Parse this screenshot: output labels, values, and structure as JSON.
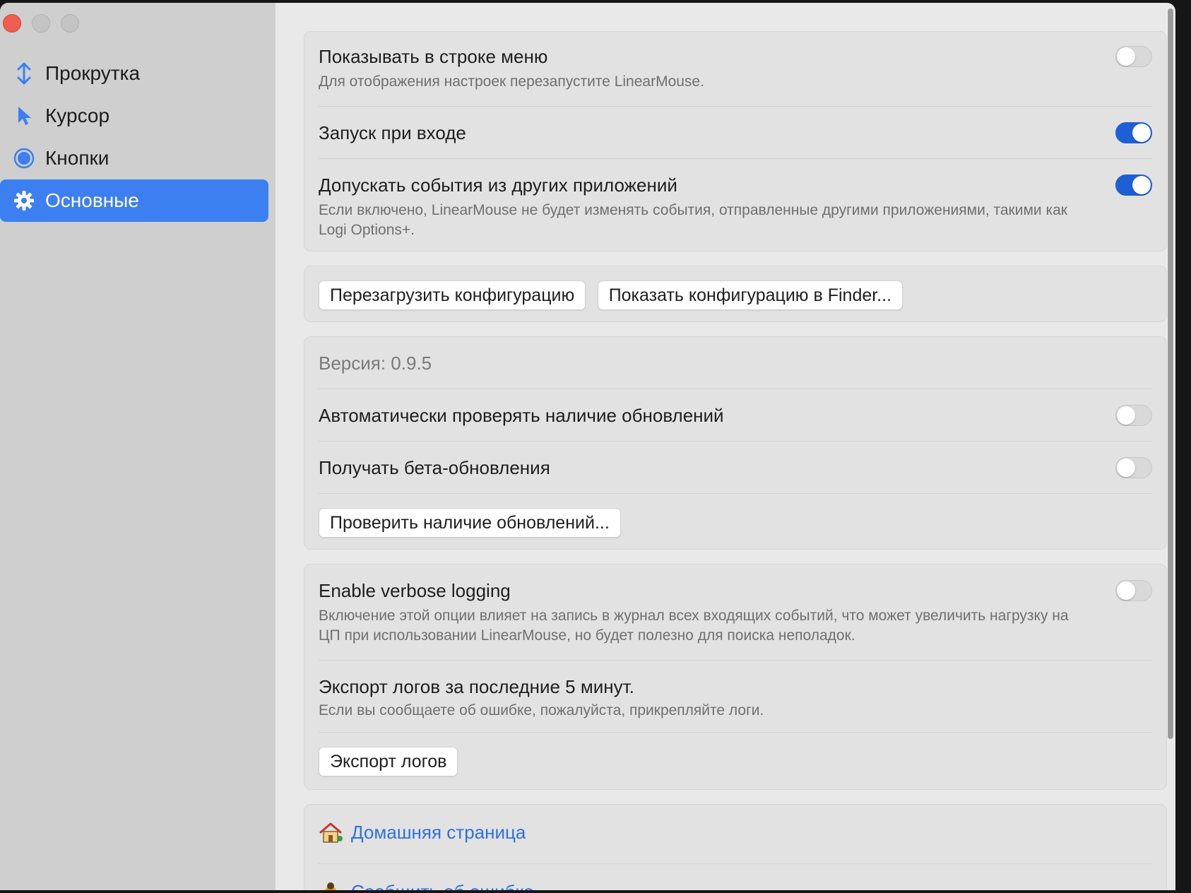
{
  "sidebar": {
    "items": [
      {
        "label": "Прокрутка",
        "icon": "scroll-arrows-icon"
      },
      {
        "label": "Курсор",
        "icon": "cursor-arrow-icon"
      },
      {
        "label": "Кнопки",
        "icon": "circle-button-icon"
      },
      {
        "label": "Основные",
        "icon": "gear-icon",
        "active": true
      }
    ]
  },
  "general": {
    "menubar": {
      "title": "Показывать в строке меню",
      "desc": "Для отображения настроек перезапустите LinearMouse.",
      "on": false
    },
    "login": {
      "title": "Запуск при входе",
      "on": true
    },
    "passthrough": {
      "title": "Допускать события из других приложений",
      "desc": "Если включено, LinearMouse не будет изменять события, отправленные другими приложениями, такими как Logi Options+.",
      "on": true
    }
  },
  "config": {
    "reload_label": "Перезагрузить конфигурацию",
    "reveal_label": "Показать конфигурацию в Finder..."
  },
  "updates": {
    "version": "Версия: 0.9.5",
    "auto_check": {
      "title": "Автоматически проверять наличие обновлений",
      "on": false
    },
    "beta": {
      "title": "Получать бета-обновления",
      "on": false
    },
    "check_label": "Проверить наличие обновлений..."
  },
  "logging": {
    "verbose": {
      "title": "Enable verbose logging",
      "desc": "Включение этой опции влияет на запись в журнал всех входящих событий, что может увеличить нагрузку на ЦП при использовании LinearMouse, но будет полезно для поиска неполадок.",
      "on": false
    },
    "export": {
      "title": "Экспорт логов за последние 5 минут.",
      "desc": "Если вы сообщаете об ошибке, пожалуйста, прикрепляйте логи."
    },
    "export_label": "Экспорт логов"
  },
  "links": {
    "homepage": "Домашняя страница",
    "bug_report": "Сообщить об ошибке"
  },
  "colors": {
    "accent": "#3c7ff0",
    "toggle_on": "#1f5fd6",
    "link": "#2f6fe0"
  }
}
